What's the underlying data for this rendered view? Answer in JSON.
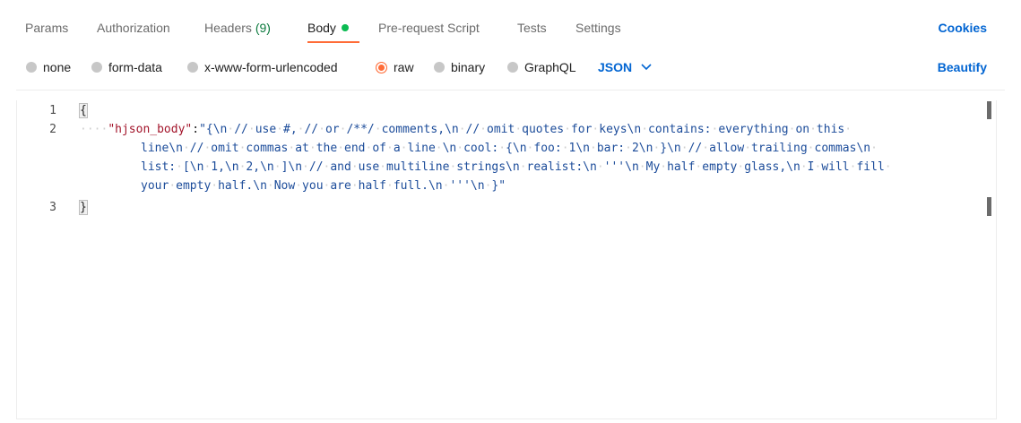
{
  "tabs": {
    "params": "Params",
    "authorization": "Authorization",
    "headers_label": "Headers",
    "headers_count": "(9)",
    "body": "Body",
    "prerequest": "Pre-request Script",
    "tests": "Tests",
    "settings": "Settings",
    "cookies": "Cookies"
  },
  "body_modes": {
    "none": "none",
    "form_data": "form-data",
    "urlencoded": "x-www-form-urlencoded",
    "raw": "raw",
    "binary": "binary",
    "graphql": "GraphQL",
    "selected": "raw",
    "format": "JSON",
    "beautify": "Beautify"
  },
  "editor": {
    "line_numbers": [
      "1",
      "2",
      "3"
    ],
    "open_brace": "{",
    "close_brace": "}",
    "indent": "····",
    "key": "\"hjson_body\"",
    "colon": ":",
    "value_lines": [
      "\"{\\n·//·use·#,·//·or·/**/·comments,\\n·//·omit·quotes·for·keys\\n·contains:·everything·on·this·",
      "line\\n·//·omit·commas·at·the·end·of·a·line·\\n·cool:·{\\n·foo:·1\\n·bar:·2\\n·}\\n·//·allow·trailing·commas\\n·",
      "list:·[\\n·1,\\n·2,\\n·]\\n·//·and·use·multiline·strings\\n·realist:\\n·'''\\n·My·half·empty·glass,\\n·I·will·fill·",
      "your·empty·half.\\n·Now·you·are·half·full.\\n·'''\\n·}\""
    ]
  },
  "colors": {
    "accent_orange": "#ff6c37",
    "link_blue": "#0265d2",
    "status_green": "#0cbb52"
  }
}
